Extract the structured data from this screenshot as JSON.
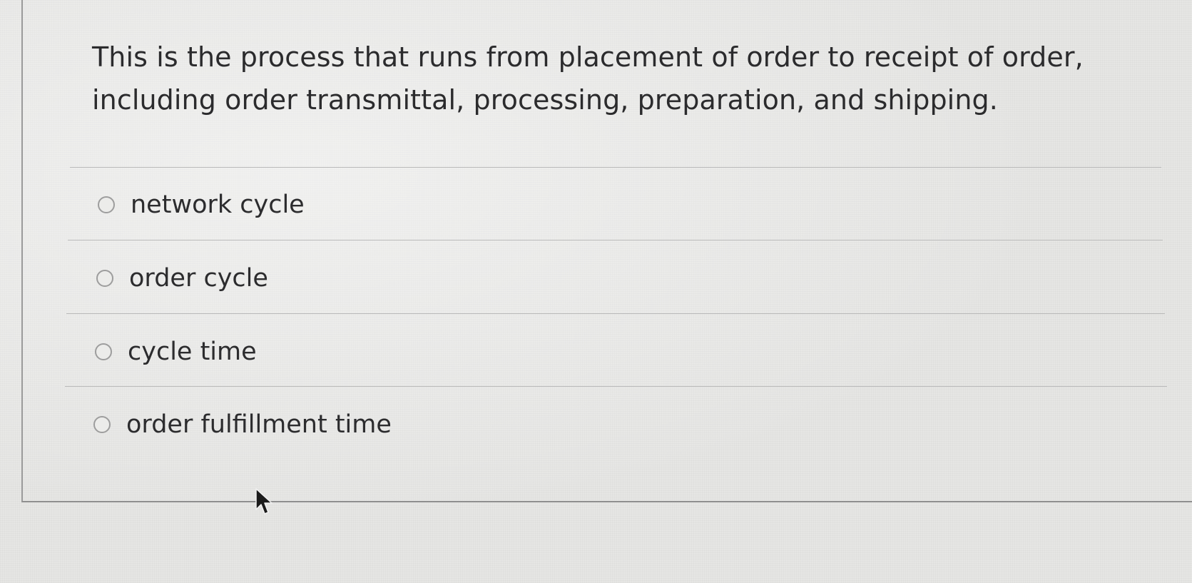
{
  "question": {
    "text": "This is the process that runs from placement of order to receipt of order, including order transmittal, processing, preparation, and shipping."
  },
  "options": [
    {
      "label": "network cycle",
      "selected": false
    },
    {
      "label": "order cycle",
      "selected": false
    },
    {
      "label": "cycle time",
      "selected": false
    },
    {
      "label": "order fulfillment time",
      "selected": false
    }
  ],
  "cursor": {
    "icon": "arrow-pointer-icon"
  }
}
